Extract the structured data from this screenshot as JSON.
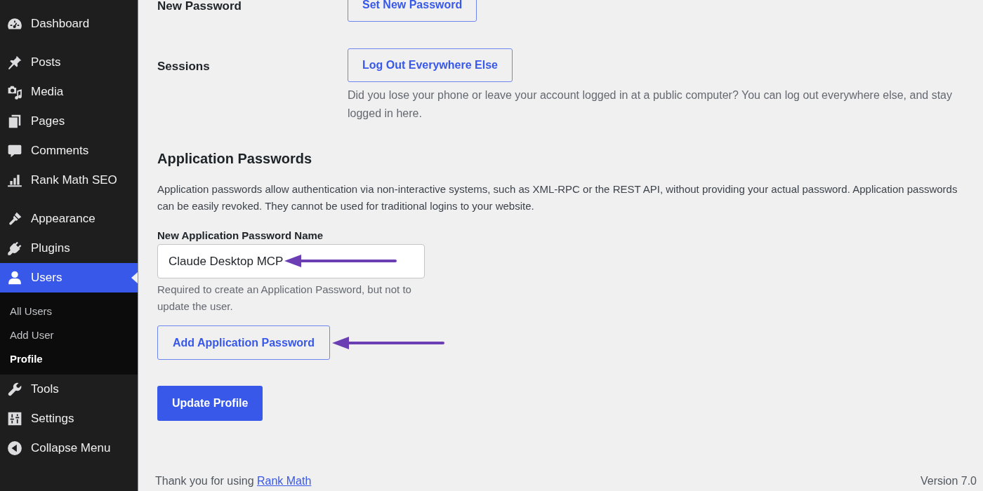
{
  "sidebar": {
    "groups": [
      {
        "items": [
          {
            "label": "Dashboard",
            "selected": false
          }
        ]
      },
      {
        "items": [
          {
            "label": "Posts",
            "selected": false
          },
          {
            "label": "Media",
            "selected": false
          },
          {
            "label": "Pages",
            "selected": false
          },
          {
            "label": "Comments",
            "selected": false
          },
          {
            "label": "Rank Math SEO",
            "selected": false
          }
        ]
      },
      {
        "items": [
          {
            "label": "Appearance",
            "selected": false
          },
          {
            "label": "Plugins",
            "selected": false
          },
          {
            "label": "Users",
            "selected": true,
            "submenu": [
              {
                "label": "All Users",
                "selected": false
              },
              {
                "label": "Add User",
                "selected": false
              },
              {
                "label": "Profile",
                "selected": true
              }
            ]
          },
          {
            "label": "Tools",
            "selected": false
          },
          {
            "label": "Settings",
            "selected": false
          }
        ]
      }
    ],
    "collapse_button": "Collapse Menu"
  },
  "profile": {
    "rows": [
      {
        "label": "New Password",
        "button": "Set New Password"
      },
      {
        "label": "Sessions",
        "button": "Log Out Everywhere Else",
        "description": "Did you lose your phone or leave your account logged in at a public computer? You can log out everywhere else, and stay logged in here."
      }
    ],
    "application_passwords": {
      "heading": "Application Passwords",
      "description": "Application passwords allow authentication via non-interactive systems, such as XML-RPC or the REST API, without providing your actual password. Application passwords can be easily revoked. They cannot be used for traditional logins to your website.",
      "field": {
        "label": "New Application Password Name",
        "value": "Claude Desktop MCP",
        "help": "Required to create an Application Password, but not to update the user.",
        "annotation_arrow": true
      },
      "add_button": {
        "label": "Add Application Password",
        "annotation_arrow": true
      }
    },
    "submit_button": "Update Profile"
  },
  "footer": {
    "credit_text": "Thank you for using",
    "credit_link": "Rank Math",
    "version": "Version 7.0"
  }
}
